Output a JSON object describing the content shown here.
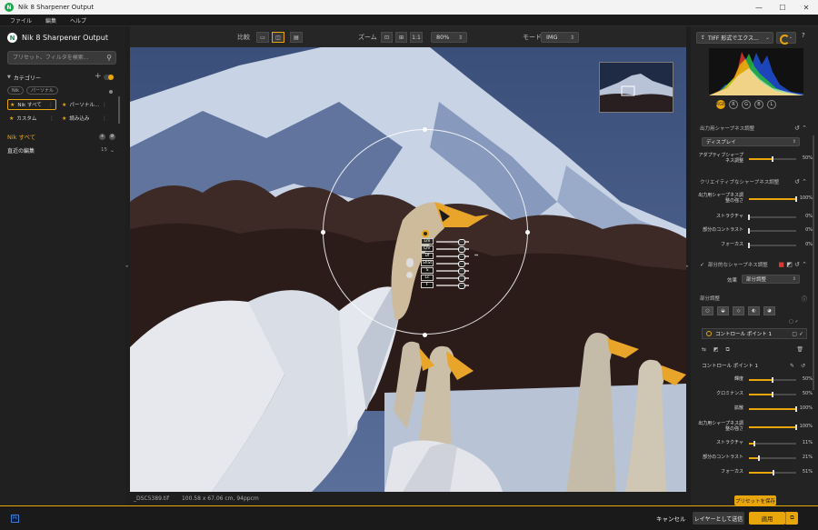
{
  "window": {
    "title": "Nik 8 Sharpener Output",
    "min_glyph": "—",
    "max_glyph": "☐",
    "close_glyph": "✕"
  },
  "menu": [
    "ファイル",
    "編集",
    "ヘルプ"
  ],
  "left": {
    "brand": "Nik 8 Sharpener Output",
    "search_placeholder": "プリセット、フィルタを検索...",
    "category_title": "カテゴリー",
    "filter_chips": [
      "Nik",
      "パーソナル"
    ],
    "categories": [
      {
        "label": "Nik すべて",
        "active": true
      },
      {
        "label": "パーソナル...",
        "active": false
      },
      {
        "label": "カスタム",
        "active": false
      },
      {
        "label": "読み込み",
        "active": false
      }
    ],
    "nik_all": "Nik すべて",
    "recent_label": "直近の編集",
    "recent_count": "15"
  },
  "toolbar": {
    "compare_label": "比較",
    "zoom_label": "ズーム",
    "zoom_one_to_one": "1:1",
    "zoom_value": "80%",
    "mode_label": "モード",
    "mode_value": "IMG"
  },
  "control_point": {
    "sliders": [
      "Lm",
      "Chr",
      "Df",
      "ShSt",
      "S",
      "Lc",
      "F"
    ]
  },
  "status": {
    "filename": "_DSC5389.tif",
    "dimensions": "100.58 x 67.06 cm, 94ppcm"
  },
  "right": {
    "export_label": "TIFF 形式でエクス...",
    "help": "?",
    "hist_channels": [
      "RGB",
      "R",
      "G",
      "B",
      "L"
    ],
    "output_sharpen": {
      "title": "出力用シャープネス調整",
      "select": "ディスプレイ",
      "sliders": [
        {
          "label": "アダプティブシャープネス調整",
          "value": 50,
          "display": "50%"
        }
      ]
    },
    "creative_sharpen": {
      "title": "クリエイティブなシャープネス調整",
      "sliders": [
        {
          "label": "出力用シャープネス調整の強さ",
          "value": 100,
          "display": "100%"
        },
        {
          "label": "ストラクチャ",
          "value": 0,
          "display": "0%"
        },
        {
          "label": "部分のコントラスト",
          "value": 0,
          "display": "0%"
        },
        {
          "label": "フォーカス",
          "value": 0,
          "display": "0%"
        }
      ]
    },
    "selective_sharpen": {
      "title": "部分的なシャープネス調整",
      "effect_label": "効果",
      "effect_value": "部分調整"
    },
    "local_adjust": {
      "title": "部分調整",
      "cp_item": "コントロール ポイント 1",
      "cp_name": "コントロール ポイント 1",
      "sliders": [
        {
          "label": "輝度",
          "value": 50,
          "display": "50%"
        },
        {
          "label": "クロミナンス",
          "value": 50,
          "display": "50%"
        },
        {
          "label": "拡散",
          "value": 100,
          "display": "100%"
        },
        {
          "label": "出力用シャープネス調整の強さ",
          "value": 100,
          "display": "100%"
        },
        {
          "label": "ストラクチャ",
          "value": 11,
          "display": "11%"
        },
        {
          "label": "部分のコントラスト",
          "value": 21,
          "display": "21%"
        },
        {
          "label": "フォーカス",
          "value": 51,
          "display": "51%"
        }
      ]
    },
    "save_preset": "プリセットを保存"
  },
  "bottom": {
    "ps_badge": "Ps",
    "cancel": "キャンセル",
    "send_as_layer": "レイヤーとして送信",
    "apply": "適用"
  },
  "colors": {
    "accent": "#e8a60a",
    "panel": "#232323",
    "background": "#1e1e1e"
  }
}
